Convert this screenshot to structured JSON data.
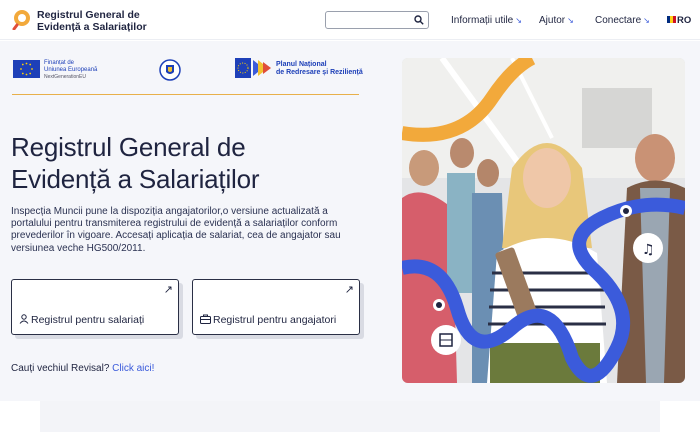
{
  "header": {
    "brand_line1": "Registrul General de",
    "brand_line2": "Evidență a Salariaților",
    "search_placeholder": "",
    "nav": [
      {
        "label": "Informații utile",
        "arrow": "↘"
      },
      {
        "label": "Ajutor",
        "arrow": "↘"
      },
      {
        "label": "Conectare",
        "arrow": "↘"
      }
    ],
    "language": "RO"
  },
  "funding": {
    "eu_line1": "Finanțat de",
    "eu_line2": "Uniunea Europeană",
    "eu_line3": "NextGenerationEU",
    "pnrr_line1": "Planul Național",
    "pnrr_line2": "de Redresare și Reziliență"
  },
  "hero": {
    "title_line1": "Registrul General de",
    "title_line2": "Evidență a Salariaților",
    "description": "Inspecția Muncii pune la dispoziția angajatorilor,o versiune actualizată a portalului pentru transmiterea registrului de evidență a salariaților conform prevederilor în vigoare. Accesați aplicația de salariat, cea de angajator sau versiunea veche HG500/2011.",
    "cards": [
      {
        "label": "Registrul pentru salariați",
        "icon": "user-icon"
      },
      {
        "label": "Registrul pentru angajatori",
        "icon": "briefcase-icon"
      }
    ],
    "revisal_text": "Cauți vechiul Revisal?",
    "revisal_link": "Click aici!"
  },
  "colors": {
    "accent_blue": "#3b5bdb",
    "accent_orange": "#f2a93b",
    "dark_text": "#1f2440"
  }
}
